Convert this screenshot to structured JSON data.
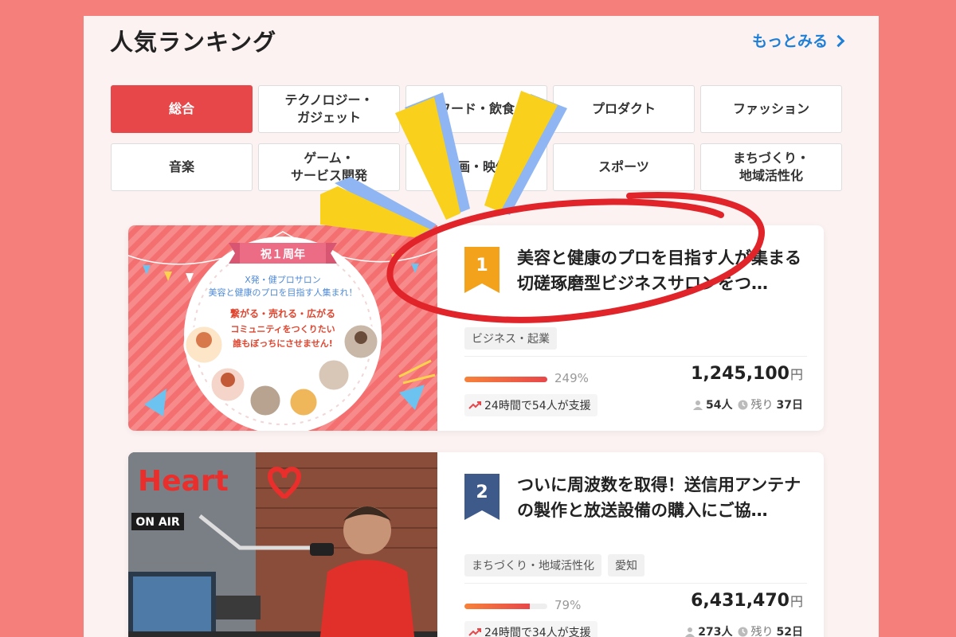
{
  "header": {
    "title": "人気ランキング",
    "more_label": "もっとみる"
  },
  "categories": [
    {
      "label": "総合",
      "active": true
    },
    {
      "label": "テクノロジー・\nガジェット",
      "active": false
    },
    {
      "label": "フード・飲食",
      "active": false
    },
    {
      "label": "プロダクト",
      "active": false
    },
    {
      "label": "ファッション",
      "active": false
    },
    {
      "label": "音楽",
      "active": false
    },
    {
      "label": "ゲーム・\nサービス開発",
      "active": false
    },
    {
      "label": "映画・映像",
      "active": false
    },
    {
      "label": "スポーツ",
      "active": false
    },
    {
      "label": "まちづくり・\n地域活性化",
      "active": false
    }
  ],
  "projects": [
    {
      "rank": "1",
      "rank_color": "#f3a21b",
      "title": "美容と健康のプロを目指す人が集まる切磋琢磨型ビジネスサロンをつ…",
      "tags": [
        "ビジネス・起業"
      ],
      "progress_percent": 249,
      "progress_label": "249%",
      "amount": "1,245,100",
      "currency": "円",
      "recent_support": "24時間で54人が支援",
      "supporters": "54人",
      "remaining_prefix": "残り",
      "remaining": "37日",
      "thumb": {
        "badge": "祝１周年",
        "line1": "X発・健プロサロン",
        "line2": "美容と健康のプロを目指す人集まれ！",
        "line3": "繋がる・売れる・広がる",
        "line4": "コミュニティをつくりたい",
        "line5": "誰もぼっちにさせません!"
      }
    },
    {
      "rank": "2",
      "rank_color": "#3d5a8a",
      "title": "ついに周波数を取得！送信用アンテナの製作と放送設備の購入にご協…",
      "tags": [
        "まちづくり・地域活性化",
        "愛知"
      ],
      "progress_percent": 79,
      "progress_label": "79%",
      "amount": "6,431,470",
      "currency": "円",
      "recent_support": "24時間で34人が支援",
      "supporters": "273人",
      "remaining_prefix": "残り",
      "remaining": "52日",
      "thumb": {
        "logo": "Heart",
        "onair": "ON AIR"
      }
    }
  ],
  "colors": {
    "background": "#f47f7b",
    "accent": "#e8474a",
    "link": "#1f7fd6",
    "highlight_yellow": "#f9d01c",
    "highlight_blue": "#8fb6f2",
    "circle_red": "#e0242a"
  }
}
